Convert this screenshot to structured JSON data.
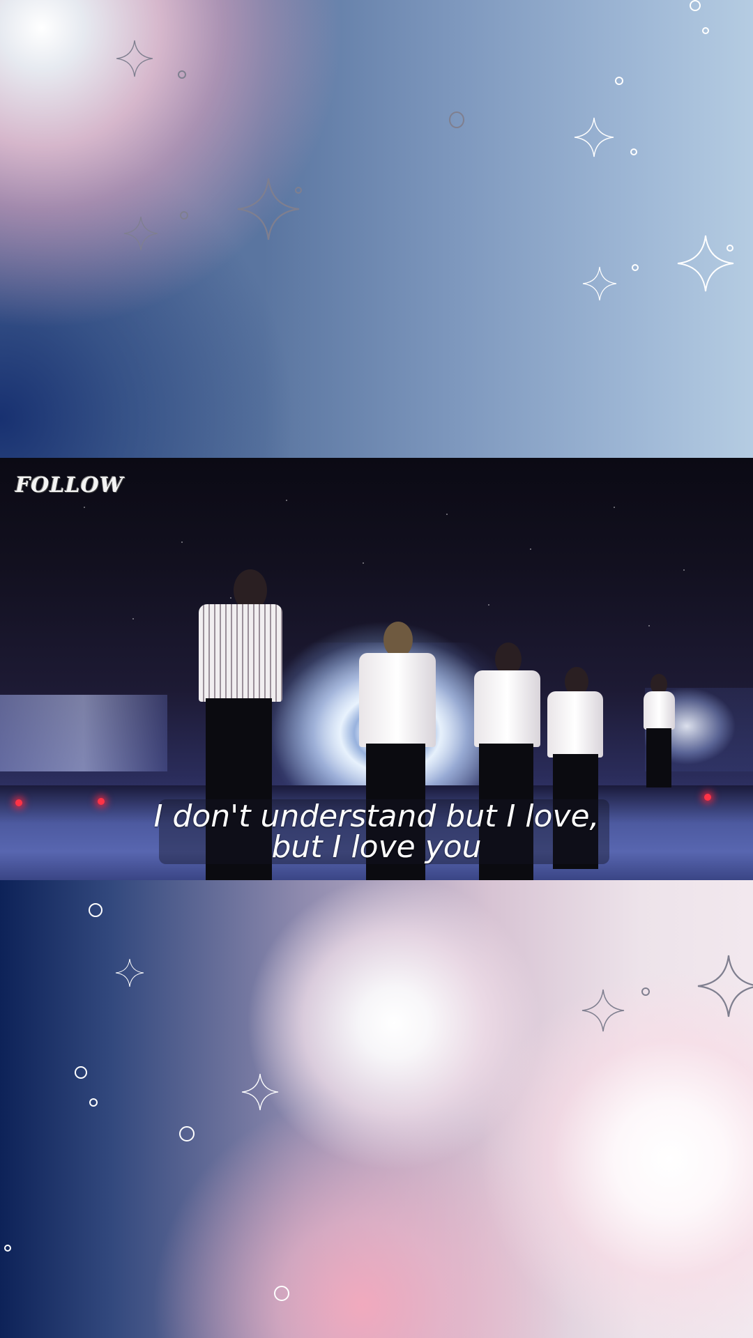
{
  "video": {
    "logo_text": "FOLLOW",
    "caption": {
      "line1": "I don't understand but I love,",
      "line2": "but I love you"
    }
  },
  "colors": {
    "top_bg_accent": "#5a75a0",
    "bottom_bg_accent": "#0d2258",
    "pink_glow": "#f0b4c6",
    "sparkle_white": "#ffffff",
    "sparkle_gray": "#7f7f8f"
  },
  "icons": [
    "sparkle-icon",
    "circle-doodle-icon",
    "logo"
  ]
}
